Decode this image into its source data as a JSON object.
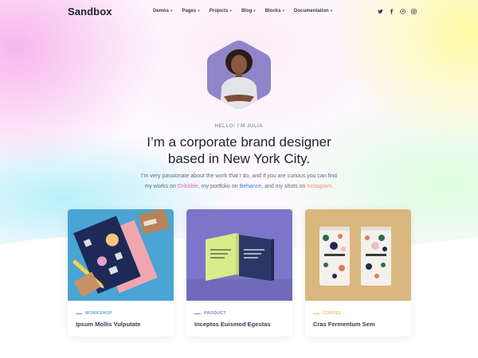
{
  "brand": {
    "logo_text": "Sandbox"
  },
  "nav": {
    "items": [
      {
        "label": "Demos"
      },
      {
        "label": "Pages"
      },
      {
        "label": "Projects"
      },
      {
        "label": "Blog"
      },
      {
        "label": "Blocks"
      },
      {
        "label": "Documentation"
      }
    ],
    "social_icons": [
      "twitter-icon",
      "facebook-icon",
      "pinterest-icon",
      "instagram-icon"
    ]
  },
  "hero": {
    "greeting": "HELLO! I'M JULIA",
    "headline_line1": "I’m a corporate brand designer",
    "headline_line2": "based in New York City.",
    "intro_part1": "I’m very passionate about the work that I do, and if you are curious you can find",
    "intro_part2": "my works on ",
    "link_dribbble": "Dribbble",
    "intro_part3": ", my portfolio on ",
    "link_behance": "Behance",
    "intro_part4": ", and my shots on ",
    "link_instagram": "Instagram",
    "intro_part5": "."
  },
  "colors": {
    "pink": "#e668b3",
    "blue": "#3f78e0",
    "orange": "#f78b77",
    "workshop": "#54a8c7",
    "product": "#747ed1",
    "coffee": "#fab758"
  },
  "cards": [
    {
      "category": "WORKSHOP",
      "title": "Ipsum Mollis Vulputate",
      "image": "book-mockup-image"
    },
    {
      "category": "PRODUCT",
      "title": "Inceptos Euismod Egestas",
      "image": "square-boxes-mockup-image"
    },
    {
      "category": "COFFEE",
      "title": "Cras Fermentum Sem",
      "image": "coffee-bags-mockup-image"
    }
  ]
}
